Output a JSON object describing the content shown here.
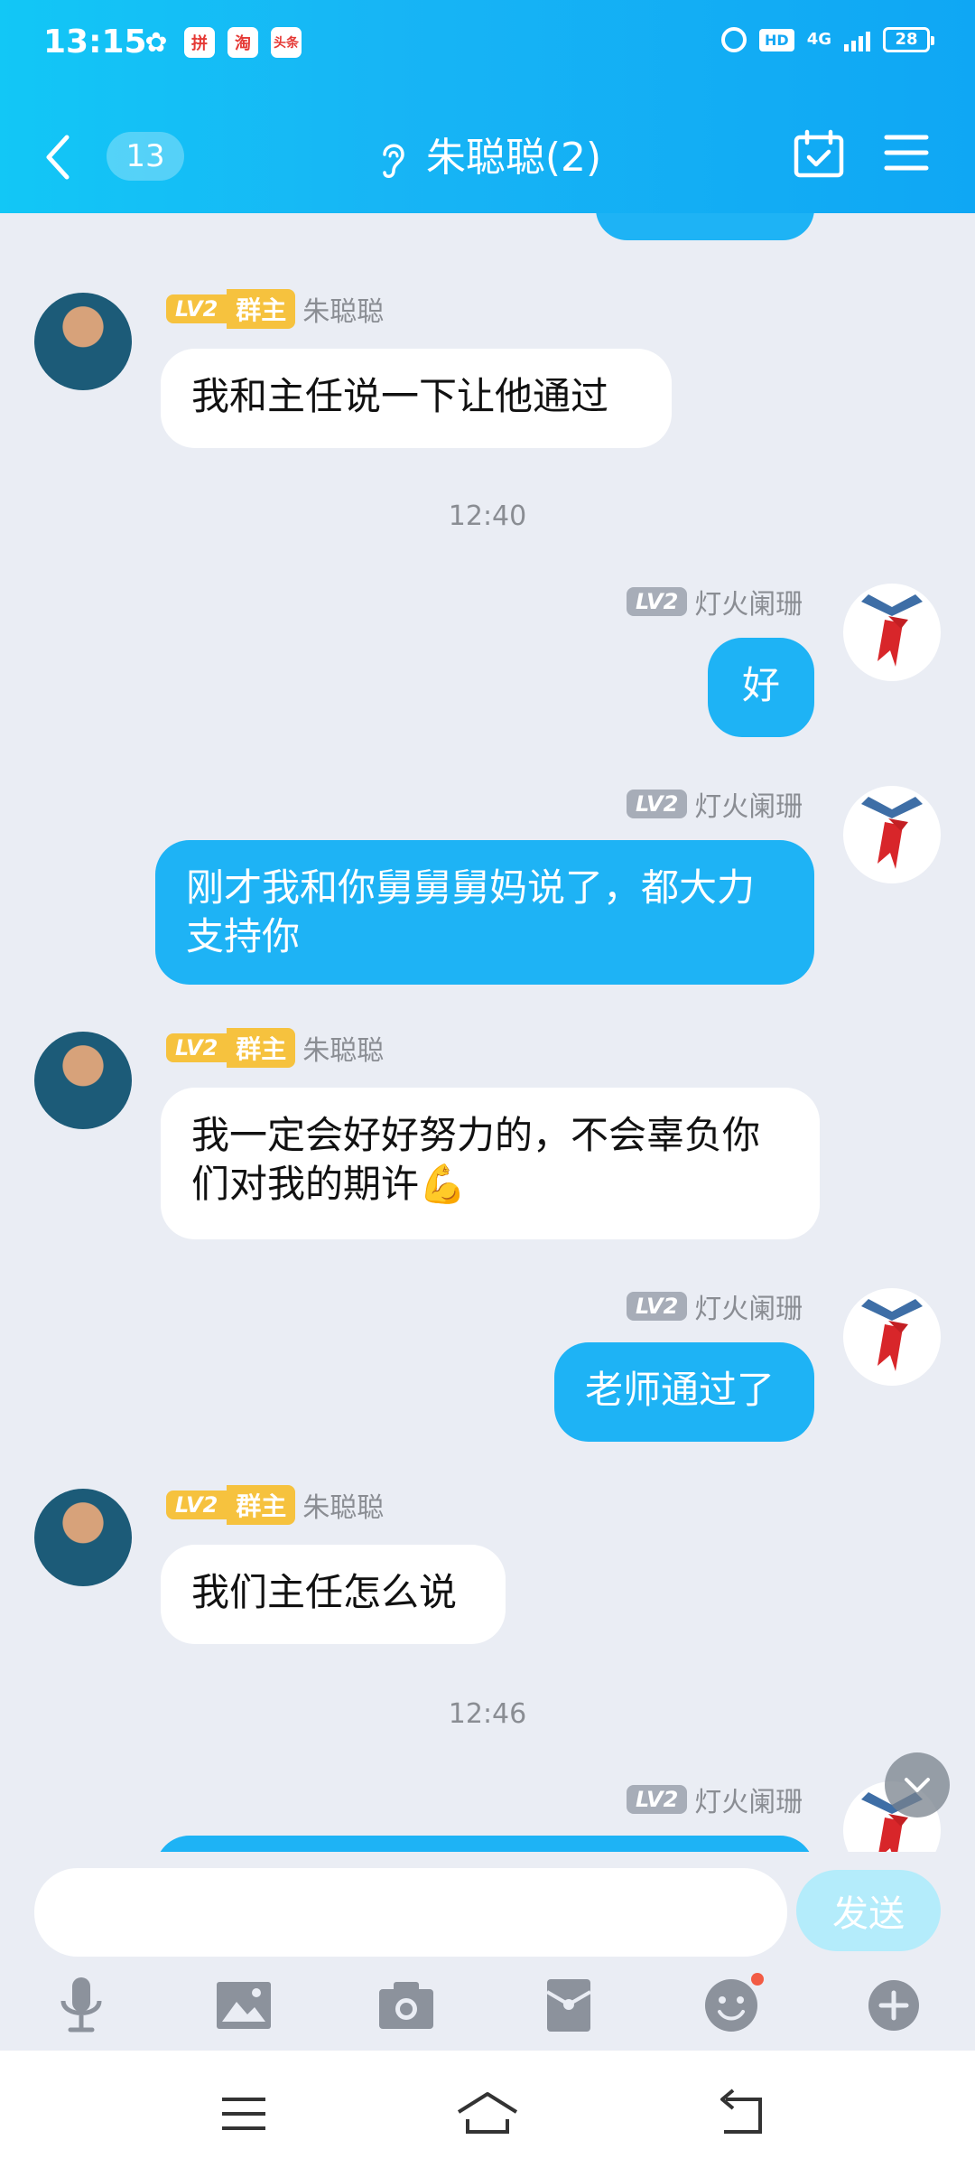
{
  "status_bar": {
    "time": "13:15",
    "app_icons": [
      "wechat-icon",
      "pinduoduo-icon",
      "taobao-icon",
      "toutiao-icon"
    ],
    "app_texts": [
      "",
      "拼",
      "淘",
      "头条"
    ],
    "hd": "HD",
    "network": "4G",
    "battery": "28"
  },
  "header": {
    "unread_count": "13",
    "title": "朱聪聪(2)"
  },
  "messages": [
    {
      "side": "left",
      "level": "LV2",
      "role": "群主",
      "sender": "朱聪聪",
      "text": "我和主任说一下让他通过"
    },
    {
      "type": "time",
      "text": "12:40"
    },
    {
      "side": "right",
      "level": "LV2",
      "sender": "灯火阑珊",
      "text": "好"
    },
    {
      "side": "right",
      "level": "LV2",
      "sender": "灯火阑珊",
      "text": "刚才我和你舅舅舅妈说了，都大力支持你"
    },
    {
      "side": "left",
      "level": "LV2",
      "role": "群主",
      "sender": "朱聪聪",
      "text": "我一定会好好努力的，不会辜负你们对我的期许💪"
    },
    {
      "side": "right",
      "level": "LV2",
      "sender": "灯火阑珊",
      "text": "老师通过了"
    },
    {
      "side": "left",
      "level": "LV2",
      "role": "群主",
      "sender": "朱聪聪",
      "text": "我们主任怎么说"
    },
    {
      "type": "time",
      "text": "12:46"
    },
    {
      "side": "right",
      "level": "LV2",
      "sender": "灯火阑珊",
      "text": ""
    }
  ],
  "input": {
    "value": "",
    "send_label": "发送"
  },
  "toolbar_icons": [
    "microphone-icon",
    "image-icon",
    "camera-icon",
    "red-packet-icon",
    "emoji-icon",
    "plus-icon"
  ],
  "colors": {
    "header": "#17b5f5",
    "bubble_right": "#1eb3f5",
    "bubble_left": "#ffffff",
    "chat_bg": "#eaedf4",
    "owner_badge": "#f6c23e"
  }
}
